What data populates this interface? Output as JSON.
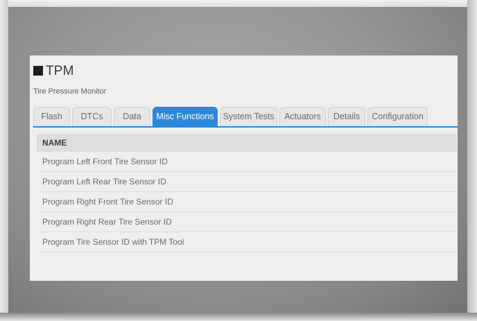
{
  "app": {
    "title": "TPM",
    "subtitle": "Tire Pressure Monitor"
  },
  "tabs": [
    {
      "label": "Flash",
      "active": false
    },
    {
      "label": "DTCs",
      "active": false
    },
    {
      "label": "Data",
      "active": false
    },
    {
      "label": "Misc Functions",
      "active": true
    },
    {
      "label": "System Tests",
      "active": false
    },
    {
      "label": "Actuators",
      "active": false
    },
    {
      "label": "Details",
      "active": false
    },
    {
      "label": "Configuration",
      "active": false
    }
  ],
  "table": {
    "header": "NAME",
    "rows": [
      "Program Left Front Tire Sensor ID",
      "Program Left Rear Tire Sensor ID",
      "Program Right Front Tire Sensor ID",
      "Program Right Rear Tire Sensor ID",
      "Program Tire Sensor ID with TPM Tool"
    ]
  },
  "colors": {
    "accent": "#2e86d6",
    "screen_background": "#efefef",
    "header_background": "#dedede"
  }
}
